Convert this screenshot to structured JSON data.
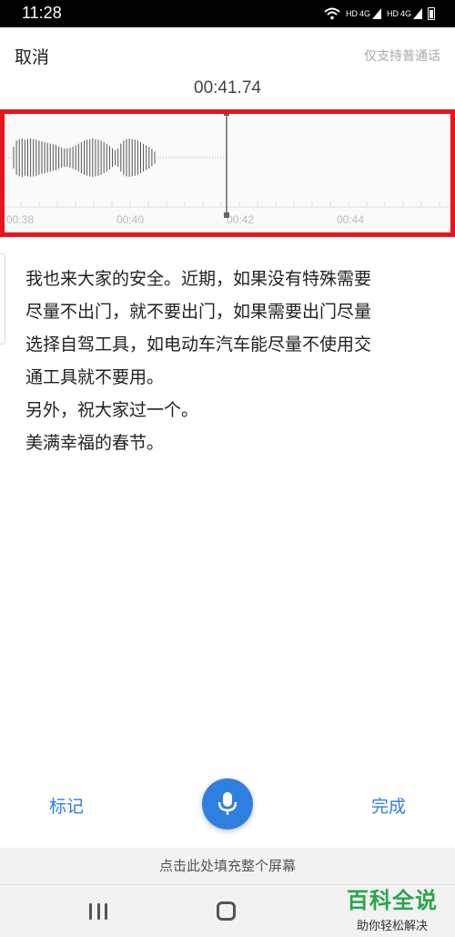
{
  "status_bar": {
    "time": "11:28",
    "net1": "HD",
    "net2": "4G",
    "net3": "HD",
    "net4": "4G"
  },
  "header": {
    "cancel_label": "取消",
    "support_note": "仅支持普通话"
  },
  "recording": {
    "timer": "00:41.74"
  },
  "waveform": {
    "time_labels": [
      "00:38",
      "00:40",
      "00:42",
      "00:44"
    ],
    "amplitudes": [
      0.35,
      0.55,
      0.6,
      0.62,
      0.58,
      0.6,
      0.62,
      0.6,
      0.58,
      0.55,
      0.52,
      0.5,
      0.48,
      0.45,
      0.42,
      0.4,
      0.36,
      0.33,
      0.3,
      0.3,
      0.32,
      0.36,
      0.4,
      0.45,
      0.5,
      0.55,
      0.58,
      0.6,
      0.62,
      0.6,
      0.58,
      0.55,
      0.5,
      0.45,
      0.38,
      0.3,
      0.25,
      0.3,
      0.45,
      0.55,
      0.6,
      0.62,
      0.6,
      0.58,
      0.55,
      0.5,
      0.45,
      0.4,
      0.35,
      0.28,
      0.2
    ],
    "playhead_progress": 0.5
  },
  "transcript": {
    "lines": [
      "我也来大家的安全。近期，如果没有特殊需要",
      "尽量不出门，就不要出门，如果需要出门尽量",
      "选择自驾工具，如电动车汽车能尽量不使用交",
      "通工具就不要用。",
      "另外，祝大家过一个。",
      "美满幸福的春节。"
    ]
  },
  "controls": {
    "mark_label": "标记",
    "done_label": "完成",
    "mic_icon": "microphone-icon"
  },
  "footer": {
    "fill_screen_label": "点击此处填充整个屏幕"
  },
  "watermark": {
    "title": "百科全说",
    "subtitle": "助你轻松解决"
  },
  "colors": {
    "accent": "#2f7fe0",
    "highlight_border": "#e8141b",
    "watermark_green": "#2aa54a"
  }
}
